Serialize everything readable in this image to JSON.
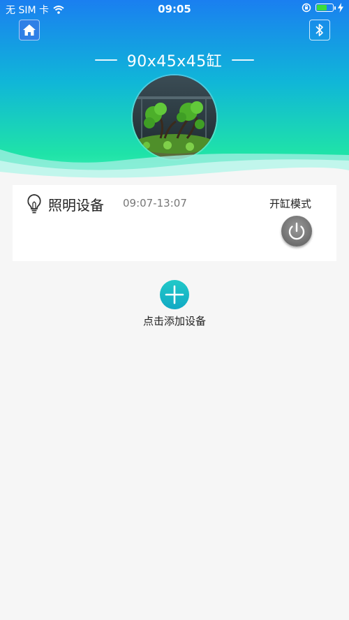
{
  "status_bar": {
    "carrier": "无 SIM 卡",
    "time": "09:05"
  },
  "header": {
    "title": "90x45x45缸"
  },
  "device": {
    "name": "照明设备",
    "schedule": "09:07-13:07",
    "mode_label": "开缸模式"
  },
  "add_device": {
    "label": "点击添加设备"
  },
  "colors": {
    "header_top": "#1a7ff0",
    "header_bottom": "#3ff0b6",
    "add_button": "#16b6c6",
    "power_button": "#6e6e6e"
  },
  "icons": [
    "wifi-icon",
    "orientation-lock-icon",
    "battery-icon",
    "charging-icon",
    "home-icon",
    "bluetooth-icon",
    "lightbulb-icon",
    "power-icon",
    "plus-icon"
  ]
}
